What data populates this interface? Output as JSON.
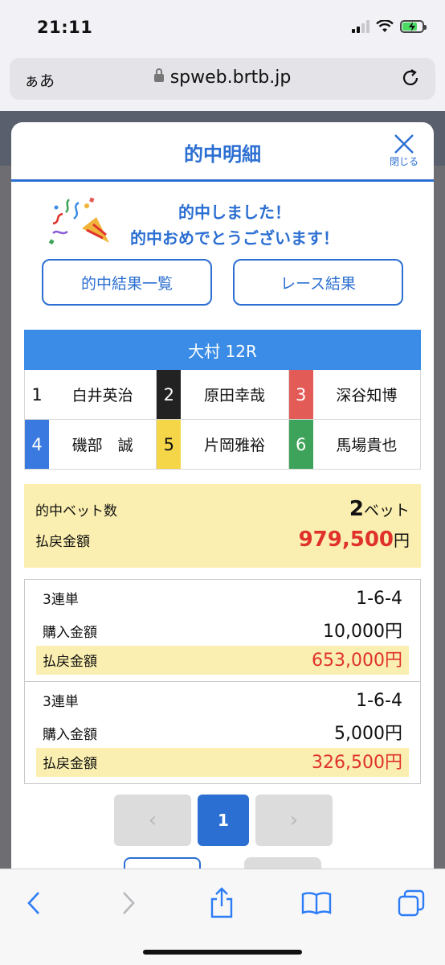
{
  "status": {
    "time": "21:11"
  },
  "browser": {
    "aa": "ぁあ",
    "url": "spweb.brtb.jp"
  },
  "modal": {
    "title": "的中明細",
    "close_label": "閉じる",
    "congrats_line1": "的中しました！",
    "congrats_line2": "的中おめでとうございます！",
    "btn_results_list": "的中結果一覧",
    "btn_race_results": "レース結果"
  },
  "race": {
    "header": "大村 12R",
    "racers": [
      {
        "lane": "1",
        "name": "白井英治",
        "bg": "#ffffff",
        "fg": "#111111"
      },
      {
        "lane": "2",
        "name": "原田幸哉",
        "bg": "#222222",
        "fg": "#ffffff"
      },
      {
        "lane": "3",
        "name": "深谷知博",
        "bg": "#e35b57",
        "fg": "#ffffff"
      },
      {
        "lane": "4",
        "name": "磯部　誠",
        "bg": "#3a7ae0",
        "fg": "#ffffff"
      },
      {
        "lane": "5",
        "name": "片岡雅裕",
        "bg": "#f4d648",
        "fg": "#111111"
      },
      {
        "lane": "6",
        "name": "馬場貴也",
        "bg": "#3ea35a",
        "fg": "#ffffff"
      }
    ]
  },
  "summary": {
    "bet_count_label": "的中ベット数",
    "bet_count": "2",
    "bet_unit": "ベット",
    "payout_label": "払戻金額",
    "payout_total": "979,500",
    "yen": "円"
  },
  "tickets": [
    {
      "type": "3連単",
      "combo": "1-6-4",
      "purchase_label": "購入金額",
      "purchase": "10,000円",
      "payout_label": "払戻金額",
      "payout": "653,000円"
    },
    {
      "type": "3連単",
      "combo": "1-6-4",
      "purchase_label": "購入金額",
      "purchase": "5,000円",
      "payout_label": "払戻金額",
      "payout": "326,500円"
    }
  ],
  "pager": {
    "prev": "‹",
    "current": "1",
    "next": "›"
  },
  "icons": [
    "back-icon",
    "forward-icon",
    "share-icon",
    "bookmarks-icon",
    "tabs-icon",
    "reload-icon",
    "lock-icon",
    "confetti-icon",
    "close-icon"
  ]
}
